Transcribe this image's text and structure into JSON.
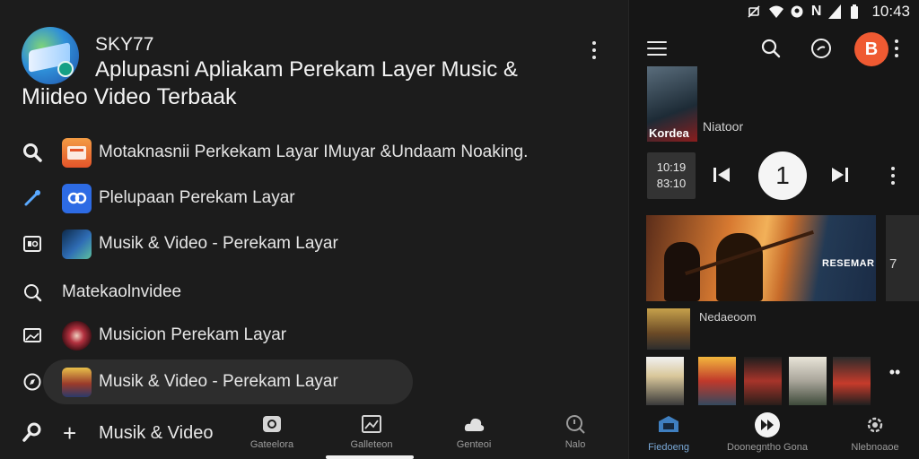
{
  "colors": {
    "background": "#1c1c1c",
    "right_pane": "#161616",
    "avatar_bg": "#ef5a32",
    "selected_pill": "#2d2d2d",
    "accent": "#7aa9d8"
  },
  "app": {
    "developer": "SKY77",
    "title_line1": "Aplupasni Apliakam Perekam  Layer Music &",
    "title_line2": "Miideo   Video Terbaak"
  },
  "list": [
    {
      "icon": "search-icon",
      "thumb": "orange-app-thumb",
      "label": "Motaknasnii Perkekam Layar  IMuyar &Undaam Noaking."
    },
    {
      "icon": "pin-icon",
      "thumb": "blue-app-thumb",
      "label": "Plelupaan  Perekam Layar"
    },
    {
      "icon": "app-box-icon",
      "thumb": "space-thumb",
      "label": "Musik & Video - Perekam Layar"
    },
    {
      "icon": "search-outline-icon",
      "thumb": "",
      "label": "Matekaolnvidee"
    },
    {
      "icon": "image-icon",
      "thumb": "vinyl-thumb",
      "label": "Musicion  Perekam Layar"
    },
    {
      "icon": "compass-icon",
      "thumb": "people-thumb",
      "label": "Musik & Video - Perekam Layar",
      "selected": true
    }
  ],
  "bottom_left": {
    "first": {
      "icon": "search-wand-icon",
      "label": "Musik & Video"
    },
    "tabs": [
      {
        "icon": "camera-icon",
        "label": "Gateelora"
      },
      {
        "icon": "gallery-icon",
        "label": "Galleteon"
      },
      {
        "icon": "cloud-icon",
        "label": "Genteoi"
      },
      {
        "icon": "search-circle-icon",
        "label": "Nalo"
      }
    ]
  },
  "status": {
    "time": "10:43",
    "indicators": "N"
  },
  "player": {
    "avatar_letter": "B",
    "now_art_title": "Kordea",
    "now_label": "Niatoor",
    "time_line1": "10:19",
    "time_line2": "83:10",
    "play_label": "1"
  },
  "banner": {
    "title": "RESEMAR",
    "peek_number": "7"
  },
  "row2_label": "Nedaeoom",
  "bottom_right": [
    {
      "icon": "tv-icon",
      "label": "Fiedoeng",
      "active": true
    },
    {
      "icon": "fast-forward-icon",
      "label": "Doonegntho Gona"
    },
    {
      "icon": "gear-puzzle-icon",
      "label": "Nlebnoaoe"
    }
  ]
}
